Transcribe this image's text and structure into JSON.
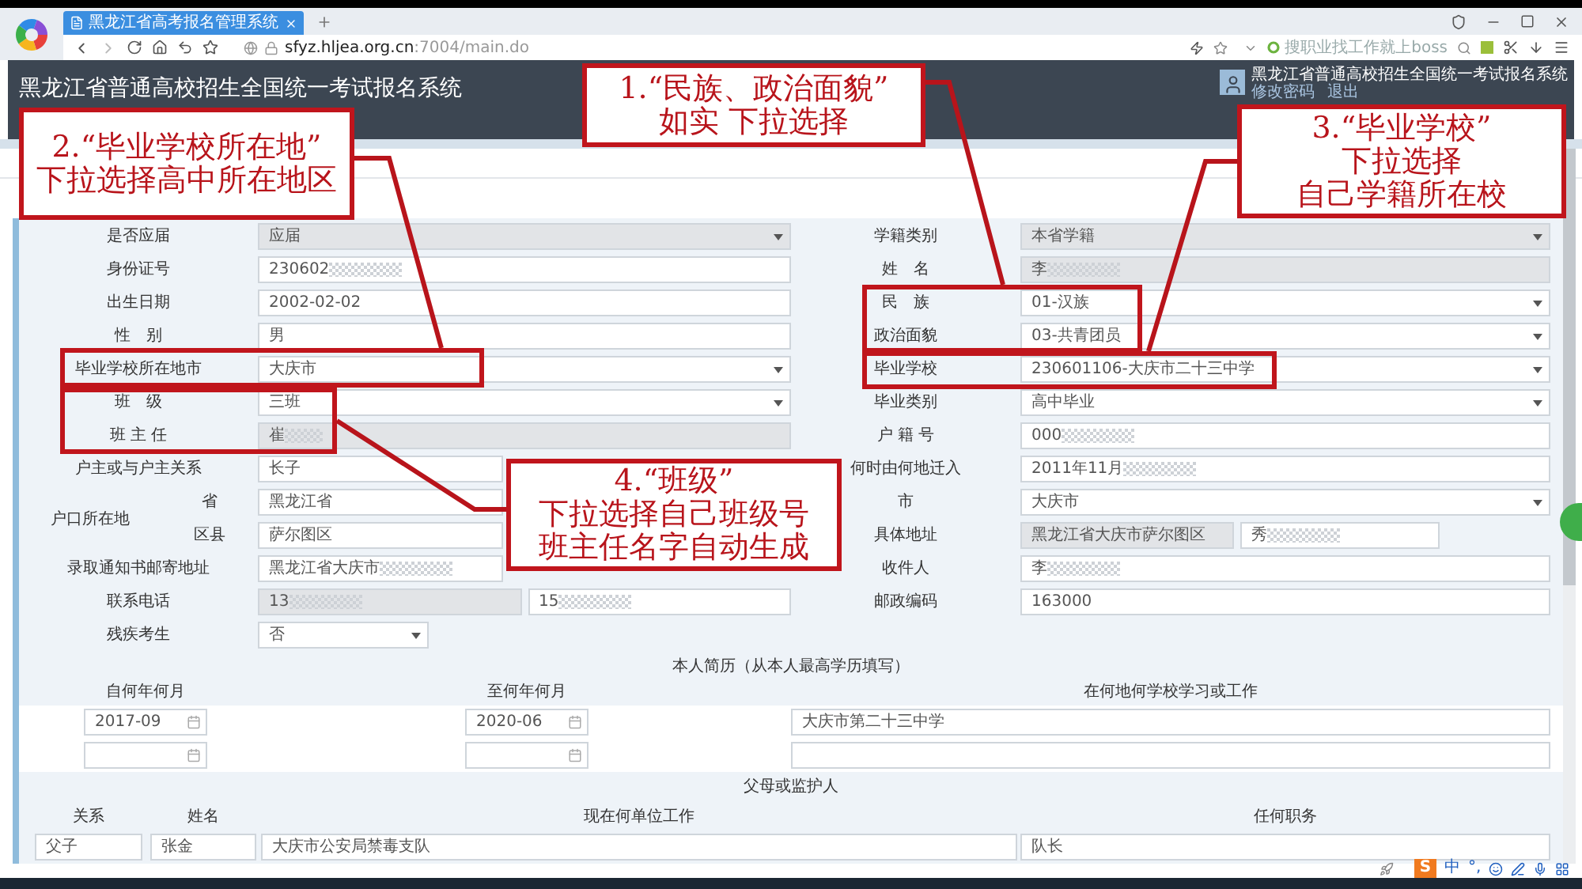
{
  "browser": {
    "tab_title": "黑龙江省高考报名管理系统",
    "url_host": "sfyz.hljea.org.cn",
    "url_path": ":7004/main.do",
    "search_placeholder": "搜职业找工作就上boss"
  },
  "header": {
    "title": "黑龙江省普通高校招生全国统一考试报名系统",
    "user_name": "黑龙江省普通高校招生全国统一考试报名系统",
    "links": [
      "修改密码",
      "退出"
    ]
  },
  "form": {
    "left_rows": [
      {
        "label": "是否应届",
        "fields": [
          {
            "kind": "select",
            "value": "应届",
            "disabled": true,
            "redacted": false
          }
        ]
      },
      {
        "label": "身份证号",
        "fields": [
          {
            "kind": "text",
            "value": "230602",
            "disabled": false,
            "redacted": true
          }
        ]
      },
      {
        "label": "出生日期",
        "fields": [
          {
            "kind": "text",
            "value": "2002-02-02",
            "disabled": false,
            "redacted": false
          }
        ]
      },
      {
        "label": "性　别",
        "fields": [
          {
            "kind": "text",
            "value": "男",
            "disabled": false,
            "redacted": false
          }
        ]
      },
      {
        "label": "毕业学校所在地市",
        "fields": [
          {
            "kind": "select",
            "value": "大庆市",
            "disabled": false,
            "redacted": false
          }
        ]
      },
      {
        "label": "班　级",
        "fields": [
          {
            "kind": "select",
            "value": "三班",
            "disabled": false,
            "redacted": false
          }
        ]
      },
      {
        "label": "班 主 任",
        "fields": [
          {
            "kind": "text",
            "value": "崔",
            "disabled": true,
            "redacted": true
          }
        ]
      },
      {
        "label": "户主或与户主关系",
        "fields": [
          {
            "kind": "text",
            "value": "长子",
            "disabled": false,
            "redacted": false
          }
        ]
      },
      {
        "label": "户口所在地",
        "children": [
          {
            "label": "省",
            "fields": [
              {
                "kind": "text",
                "value": "黑龙江省",
                "disabled": false,
                "redacted": false
              }
            ]
          },
          {
            "label": "区县",
            "fields": [
              {
                "kind": "text",
                "value": "萨尔图区",
                "disabled": false,
                "redacted": false
              }
            ]
          }
        ]
      },
      {
        "label": "录取通知书邮寄地址",
        "fields": [
          {
            "kind": "text",
            "value": "黑龙江省大庆市",
            "disabled": false,
            "redacted": true
          }
        ]
      },
      {
        "label": "联系电话",
        "fields": [
          {
            "kind": "text",
            "value": "13",
            "disabled": true,
            "redacted": true
          },
          {
            "kind": "text",
            "value": "15",
            "disabled": false,
            "redacted": true
          }
        ]
      },
      {
        "label": "残疾考生",
        "fields": [
          {
            "kind": "select",
            "value": "否",
            "disabled": false,
            "redacted": false
          }
        ]
      }
    ],
    "right_rows": [
      {
        "label": "学籍类别",
        "fields": [
          {
            "kind": "select",
            "value": "本省学籍",
            "disabled": true,
            "redacted": false
          }
        ]
      },
      {
        "label": "姓　名",
        "fields": [
          {
            "kind": "text",
            "value": "李",
            "disabled": true,
            "redacted": true
          }
        ]
      },
      {
        "label": "民　族",
        "fields": [
          {
            "kind": "select",
            "value": "01-汉族",
            "disabled": false,
            "redacted": false
          }
        ]
      },
      {
        "label": "政治面貌",
        "fields": [
          {
            "kind": "select",
            "value": "03-共青团员",
            "disabled": false,
            "redacted": false
          }
        ]
      },
      {
        "label": "毕业学校",
        "fields": [
          {
            "kind": "select",
            "value": "230601106-大庆市二十三中学",
            "disabled": false,
            "redacted": false
          }
        ]
      },
      {
        "label": "毕业类别",
        "fields": [
          {
            "kind": "select",
            "value": "高中毕业",
            "disabled": false,
            "redacted": false
          }
        ]
      },
      {
        "label": "户 籍 号",
        "fields": [
          {
            "kind": "text",
            "value": "000",
            "disabled": false,
            "redacted": true
          }
        ]
      },
      {
        "label": "何时由何地迁入",
        "fields": [
          {
            "kind": "text",
            "value": "2011年11月",
            "disabled": false,
            "redacted": true
          }
        ]
      },
      {
        "label": "市",
        "fields": [
          {
            "kind": "select",
            "value": "大庆市",
            "disabled": false,
            "redacted": false
          }
        ]
      },
      {
        "label": "具体地址",
        "fields": [
          {
            "kind": "text",
            "value": "黑龙江省大庆市萨尔图区",
            "disabled": true,
            "redacted": false
          },
          {
            "kind": "text",
            "value": "秀",
            "disabled": false,
            "redacted": true
          }
        ]
      },
      {
        "label": "收件人",
        "fields": [
          {
            "kind": "text",
            "value": "李",
            "disabled": false,
            "redacted": true
          }
        ]
      },
      {
        "label": "邮政编码",
        "fields": [
          {
            "kind": "text",
            "value": "163000",
            "disabled": false,
            "redacted": false
          }
        ]
      }
    ]
  },
  "resume": {
    "title": "本人简历（从本人最高学历填写）",
    "columns": [
      "自何年何月",
      "至何年何月",
      "在何地何学校学习或工作"
    ],
    "rows": [
      {
        "from": "2017-09",
        "to": "2020-06",
        "place": "大庆市第二十三中学"
      },
      {}
    ]
  },
  "guardians": {
    "title": "父母或监护人",
    "columns": [
      "关系",
      "姓名",
      "现在何单位工作",
      "任何职务"
    ],
    "rows": [
      {
        "relation": "父子",
        "name": "张金",
        "employer": "大庆市公安局禁毒支队",
        "position": "队长"
      }
    ]
  },
  "annotations": [
    {
      "lines": [
        "1.“民族、政治面貌”",
        "如实 下拉选择"
      ]
    },
    {
      "lines": [
        "2.“毕业学校所在地”",
        "下拉选择高中所在地区"
      ]
    },
    {
      "lines": [
        "3.“毕业学校”",
        "下拉选择",
        "自己学籍所在校"
      ]
    },
    {
      "lines": [
        "4.“班级”",
        "下拉选择自己班级号",
        "班主任名字自动生成"
      ]
    }
  ],
  "ime_bar": {
    "logo": "S",
    "mode": "中",
    "punctuation": "°,"
  }
}
